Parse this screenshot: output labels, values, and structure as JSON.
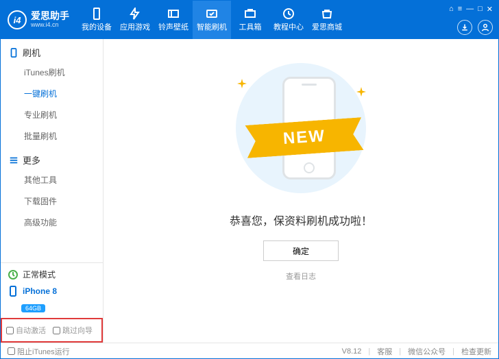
{
  "header": {
    "brand_name": "爱思助手",
    "brand_sub": "www.i4.cn",
    "tabs": [
      {
        "label": "我的设备"
      },
      {
        "label": "应用游戏"
      },
      {
        "label": "铃声壁纸"
      },
      {
        "label": "智能刷机"
      },
      {
        "label": "工具箱"
      },
      {
        "label": "教程中心"
      },
      {
        "label": "爱思商城"
      }
    ],
    "active_tab_index": 3
  },
  "sidebar": {
    "flash": {
      "title": "刷机",
      "items": [
        "iTunes刷机",
        "一键刷机",
        "专业刷机",
        "批量刷机"
      ],
      "active_index": 1
    },
    "more": {
      "title": "更多",
      "items": [
        "其他工具",
        "下载固件",
        "高级功能"
      ]
    }
  },
  "status": {
    "mode": "正常模式",
    "device": "iPhone 8",
    "storage": "64GB",
    "auto_activate": "自动激活",
    "skip_guide": "跳过向导"
  },
  "main": {
    "ribbon": "NEW",
    "message": "恭喜您，保资料刷机成功啦！",
    "ok": "确定",
    "log": "查看日志"
  },
  "footer": {
    "block_itunes": "阻止iTunes运行",
    "version": "V8.12",
    "links": [
      "客服",
      "微信公众号",
      "检查更新"
    ]
  }
}
